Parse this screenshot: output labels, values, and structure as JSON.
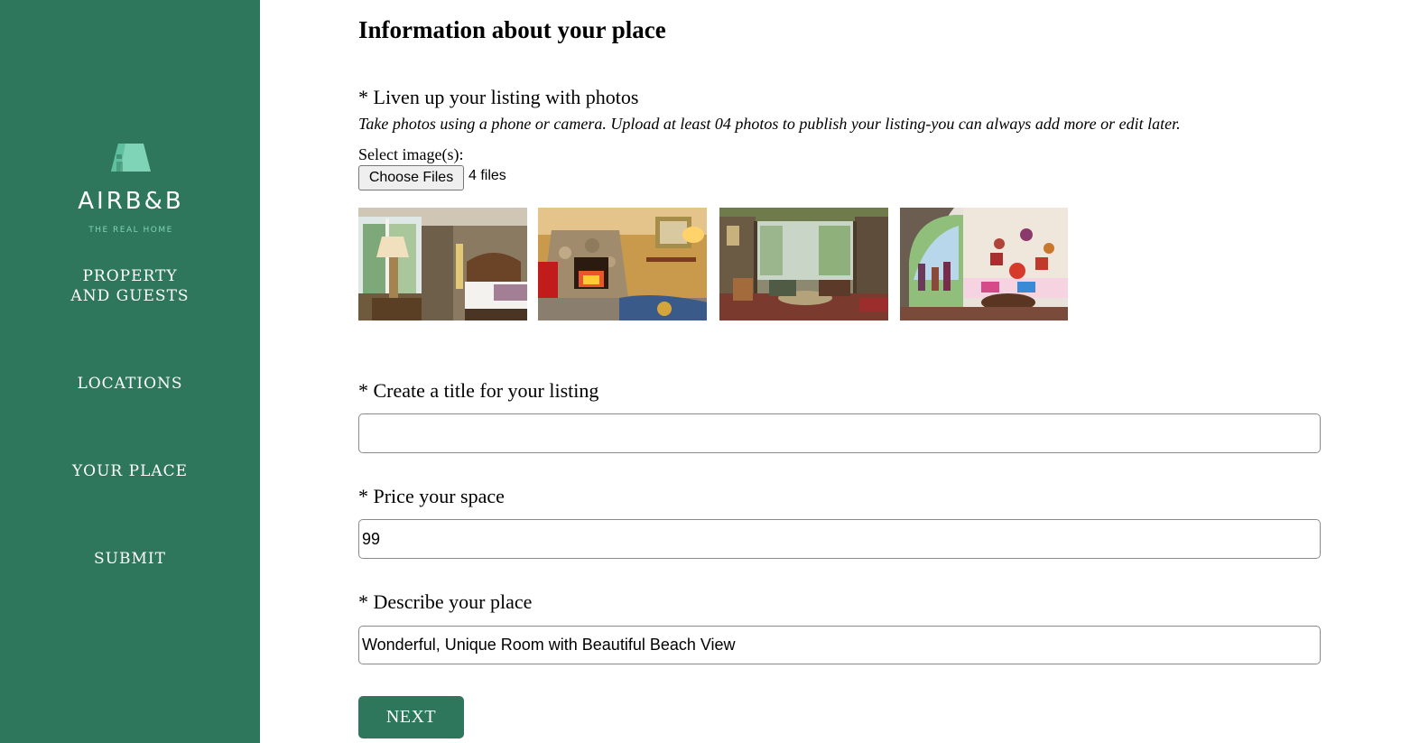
{
  "brand": {
    "name": "AIRB&B",
    "tagline": "THE REAL HOME",
    "accent_color": "#2e775c",
    "logo_color": "#7fd3b6"
  },
  "sidebar": {
    "items": [
      {
        "line1": "PROPERTY",
        "line2": "AND GUESTS"
      },
      {
        "line1": "LOCATIONS"
      },
      {
        "line1": "YOUR PLACE"
      },
      {
        "line1": "SUBMIT"
      }
    ]
  },
  "main": {
    "title": "Information about your place",
    "photos": {
      "label": "* Liven up your listing with photos",
      "hint": "Take photos using a phone or camera. Upload at least 04 photos to publish your listing-you can always add more or edit later.",
      "select_label": "Select image(s):",
      "button_label": "Choose Files",
      "file_count": "4 files",
      "images": [
        "bedroom-photo",
        "fireplace-living-room-photo",
        "terrace-lounge-photo",
        "arched-living-room-photo"
      ]
    },
    "listing_title": {
      "label": "* Create a title for your listing",
      "value": ""
    },
    "price": {
      "label": "* Price your space",
      "value": "99"
    },
    "description": {
      "label": "* Describe your place",
      "value": "Wonderful, Unique Room with Beautiful Beach View"
    },
    "next_label": "NEXT"
  }
}
